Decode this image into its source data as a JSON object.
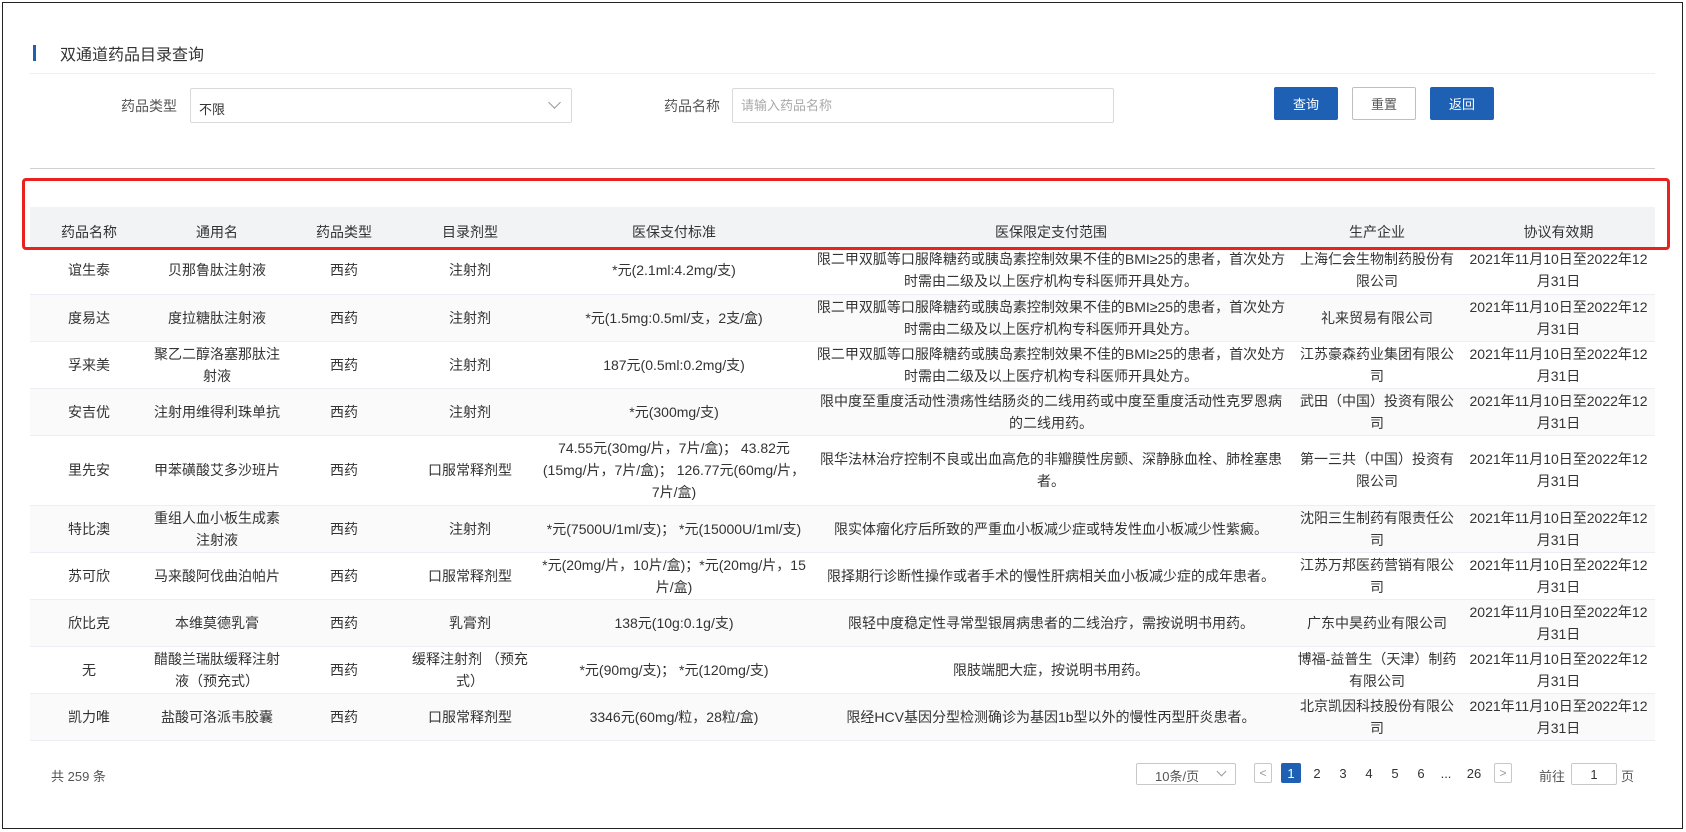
{
  "page": {
    "title": "双通道药品目录查询"
  },
  "filters": {
    "type_label": "药品类型",
    "type_value": "不限",
    "name_label": "药品名称",
    "name_placeholder": "请输入药品名称",
    "name_value": ""
  },
  "buttons": {
    "query": "查询",
    "reset": "重置",
    "back": "返回"
  },
  "table": {
    "headers": [
      "药品名称",
      "通用名",
      "药品类型",
      "目录剂型",
      "医保支付标准",
      "医保限定支付范围",
      "生产企业",
      "协议有效期"
    ],
    "rows": [
      [
        "谊生泰",
        "贝那鲁肽注射液",
        "西药",
        "注射剂",
        "*元(2.1ml:4.2mg/支)",
        "限二甲双胍等口服降糖药或胰岛素控制效果不佳的BMI≥25的患者，首次处方时需由二级及以上医疗机构专科医师开具处方。",
        "上海仁会生物制药股份有限公司",
        "2021年11月10日至2022年12月31日"
      ],
      [
        "度易达",
        "度拉糖肽注射液",
        "西药",
        "注射剂",
        "*元(1.5mg:0.5ml/支，2支/盒)",
        "限二甲双胍等口服降糖药或胰岛素控制效果不佳的BMI≥25的患者，首次处方时需由二级及以上医疗机构专科医师开具处方。",
        "礼来贸易有限公司",
        "2021年11月10日至2022年12月31日"
      ],
      [
        "孚来美",
        "聚乙二醇洛塞那肽注射液",
        "西药",
        "注射剂",
        "187元(0.5ml:0.2mg/支)",
        "限二甲双胍等口服降糖药或胰岛素控制效果不佳的BMI≥25的患者，首次处方时需由二级及以上医疗机构专科医师开具处方。",
        "江苏豪森药业集团有限公司",
        "2021年11月10日至2022年12月31日"
      ],
      [
        "安吉优",
        "注射用维得利珠单抗",
        "西药",
        "注射剂",
        "*元(300mg/支)",
        "限中度至重度活动性溃疡性结肠炎的二线用药或中度至重度活动性克罗恩病的二线用药。",
        "武田（中国）投资有限公司",
        "2021年11月10日至2022年12月31日"
      ],
      [
        "里先安",
        "甲苯磺酸艾多沙班片",
        "西药",
        "口服常释剂型",
        "74.55元(30mg/片，7片/盒)； 43.82元(15mg/片，7片/盒)； 126.77元(60mg/片，7片/盒)",
        "限华法林治疗控制不良或出血高危的非瓣膜性房颤、深静脉血栓、肺栓塞患者。",
        "第一三共（中国）投资有限公司",
        "2021年11月10日至2022年12月31日"
      ],
      [
        "特比澳",
        "重组人血小板生成素注射液",
        "西药",
        "注射剂",
        "*元(7500U/1ml/支)； *元(15000U/1ml/支)",
        "限实体瘤化疗后所致的严重血小板减少症或特发性血小板减少性紫癜。",
        "沈阳三生制药有限责任公司",
        "2021年11月10日至2022年12月31日"
      ],
      [
        "苏可欣",
        "马来酸阿伐曲泊帕片",
        "西药",
        "口服常释剂型",
        "*元(20mg/片，10片/盒)；*元(20mg/片，15片/盒)",
        "限择期行诊断性操作或者手术的慢性肝病相关血小板减少症的成年患者。",
        "江苏万邦医药营销有限公司",
        "2021年11月10日至2022年12月31日"
      ],
      [
        "欣比克",
        "本维莫德乳膏",
        "西药",
        "乳膏剂",
        "138元(10g:0.1g/支)",
        "限轻中度稳定性寻常型银屑病患者的二线治疗，需按说明书用药。",
        "广东中昊药业有限公司",
        "2021年11月10日至2022年12月31日"
      ],
      [
        "无",
        "醋酸兰瑞肽缓释注射液（预充式）",
        "西药",
        "缓释注射剂 （预充式）",
        "*元(90mg/支)； *元(120mg/支)",
        "限肢端肥大症，按说明书用药。",
        "博福-益普生（天津）制药有限公司",
        "2021年11月10日至2022年12月31日"
      ],
      [
        "凯力唯",
        "盐酸可洛派韦胶囊",
        "西药",
        "口服常释剂型",
        "3346元(60mg/粒，28粒/盒)",
        "限经HCV基因分型检测确诊为基因1b型以外的慢性丙型肝炎患者。",
        "北京凯因科技股份有限公司",
        "2021年11月10日至2022年12月31日"
      ]
    ]
  },
  "pagination": {
    "total": "共 259 条",
    "page_size": "10条/页",
    "prev": "<",
    "next": ">",
    "pages": [
      "1",
      "2",
      "3",
      "4",
      "5",
      "6",
      "...",
      "26"
    ],
    "current": "1",
    "goto_prefix": "前往",
    "goto_value": "1",
    "goto_suffix": "页"
  },
  "colors": {
    "primary": "#1e61b4",
    "highlight": "#e8231f",
    "header_bg": "#f2f3f5"
  }
}
